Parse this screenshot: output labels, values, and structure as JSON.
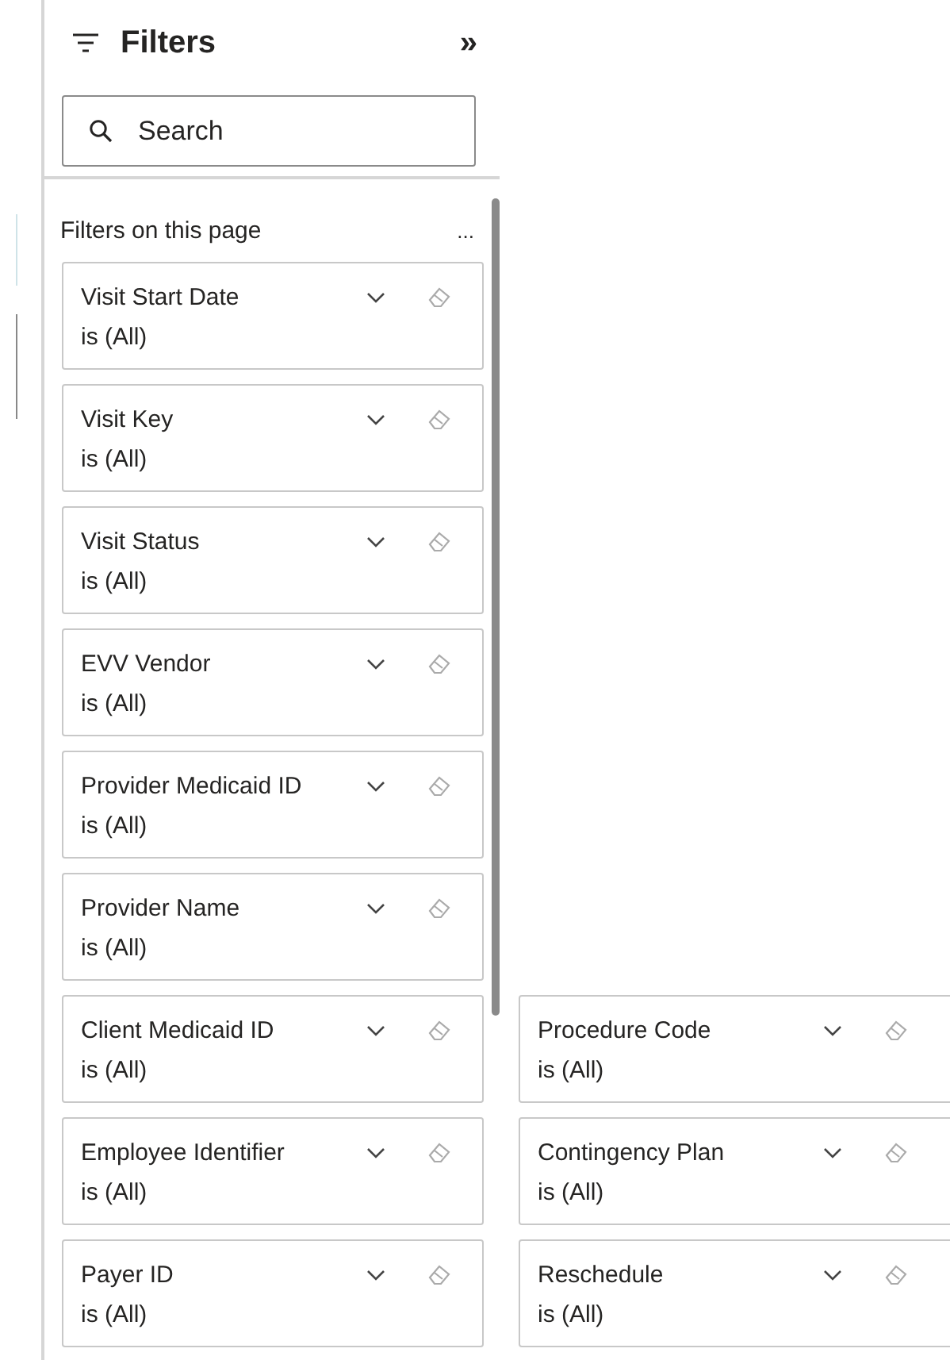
{
  "panel": {
    "title": "Filters",
    "collapse": "»",
    "search": {
      "placeholder": "Search"
    },
    "section_label": "Filters on this page",
    "more": "..."
  },
  "filter_cards": [
    {
      "name": "Visit Start Date",
      "value": "is (All)"
    },
    {
      "name": "Visit Key",
      "value": "is (All)"
    },
    {
      "name": "Visit Status",
      "value": "is (All)"
    },
    {
      "name": "EVV Vendor",
      "value": "is (All)"
    },
    {
      "name": "Provider Medicaid ID",
      "value": "is (All)"
    },
    {
      "name": "Provider Name",
      "value": "is (All)"
    },
    {
      "name": "Client Medicaid ID",
      "value": "is (All)"
    },
    {
      "name": "Employee Identifier",
      "value": "is (All)"
    },
    {
      "name": "Payer ID",
      "value": "is (All)"
    }
  ],
  "overflow_cards": [
    {
      "name": "Procedure Code",
      "value": "is (All)"
    },
    {
      "name": "Contingency Plan",
      "value": "is (All)"
    },
    {
      "name": "Reschedule",
      "value": "is (All)"
    }
  ]
}
